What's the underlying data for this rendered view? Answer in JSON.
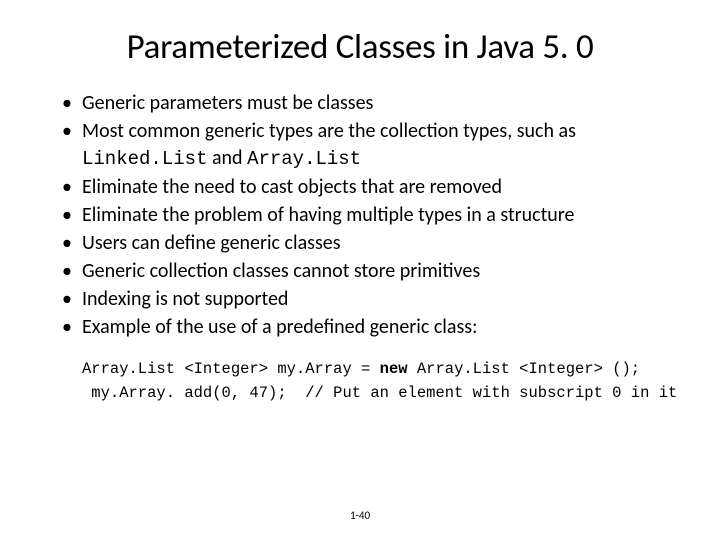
{
  "title": "Parameterized Classes in Java 5. 0",
  "bullets": [
    {
      "text": "Generic parameters must be classes"
    },
    {
      "pre": "Most common generic types are the collection types, such as ",
      "code1": "Linked.List",
      "mid": " and ",
      "code2": "Array.List"
    },
    {
      "text": "Eliminate the need to cast objects that are removed"
    },
    {
      "text": "Eliminate the problem of having multiple types in a structure"
    },
    {
      "text": "Users can define generic classes"
    },
    {
      "text": "Generic collection classes cannot store primitives"
    },
    {
      "text": "Indexing is not supported"
    },
    {
      "text": "Example of the use of a predefined generic class:"
    }
  ],
  "code": {
    "line1_pre": "Array.List <Integer> my.Array = ",
    "line1_kw": "new",
    "line1_post": " Array.List <Integer> ();",
    "line2": " my.Array. add(0, 47);  // Put an element with subscript 0 in it"
  },
  "page_number": "1-40"
}
